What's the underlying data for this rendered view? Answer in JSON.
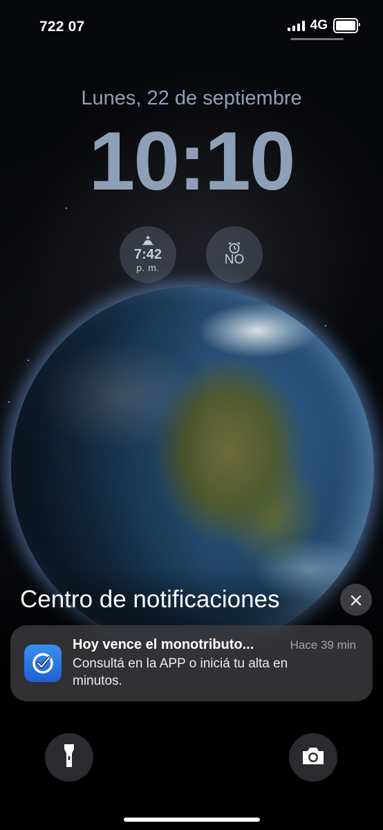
{
  "status_bar": {
    "carrier": "722 07",
    "network": "4G",
    "signal_bars": 4,
    "battery_level": 1.0
  },
  "lock_screen": {
    "date": "Lunes, 22 de septiembre",
    "time": "10:10"
  },
  "widgets": [
    {
      "icon": "sunset-icon",
      "main": "7:42",
      "sub": "p. m."
    },
    {
      "icon": "alarm-clock-icon",
      "main": "NO"
    }
  ],
  "notification_center": {
    "title": "Centro de notificaciones",
    "close_icon": "close-icon"
  },
  "notifications": [
    {
      "app_icon": "check-shield-app-icon",
      "title": "Hoy vence el monotributo...",
      "time": "Hace 39 min",
      "body": "Consultá en la APP o iniciá tu alta en minutos."
    }
  ],
  "quick_actions": {
    "left_icon": "flashlight-icon",
    "right_icon": "camera-icon"
  },
  "colors": {
    "clock_text": "#8ea0b8",
    "notification_bg": "#3c3c40",
    "app_icon": "#2b79e6"
  }
}
